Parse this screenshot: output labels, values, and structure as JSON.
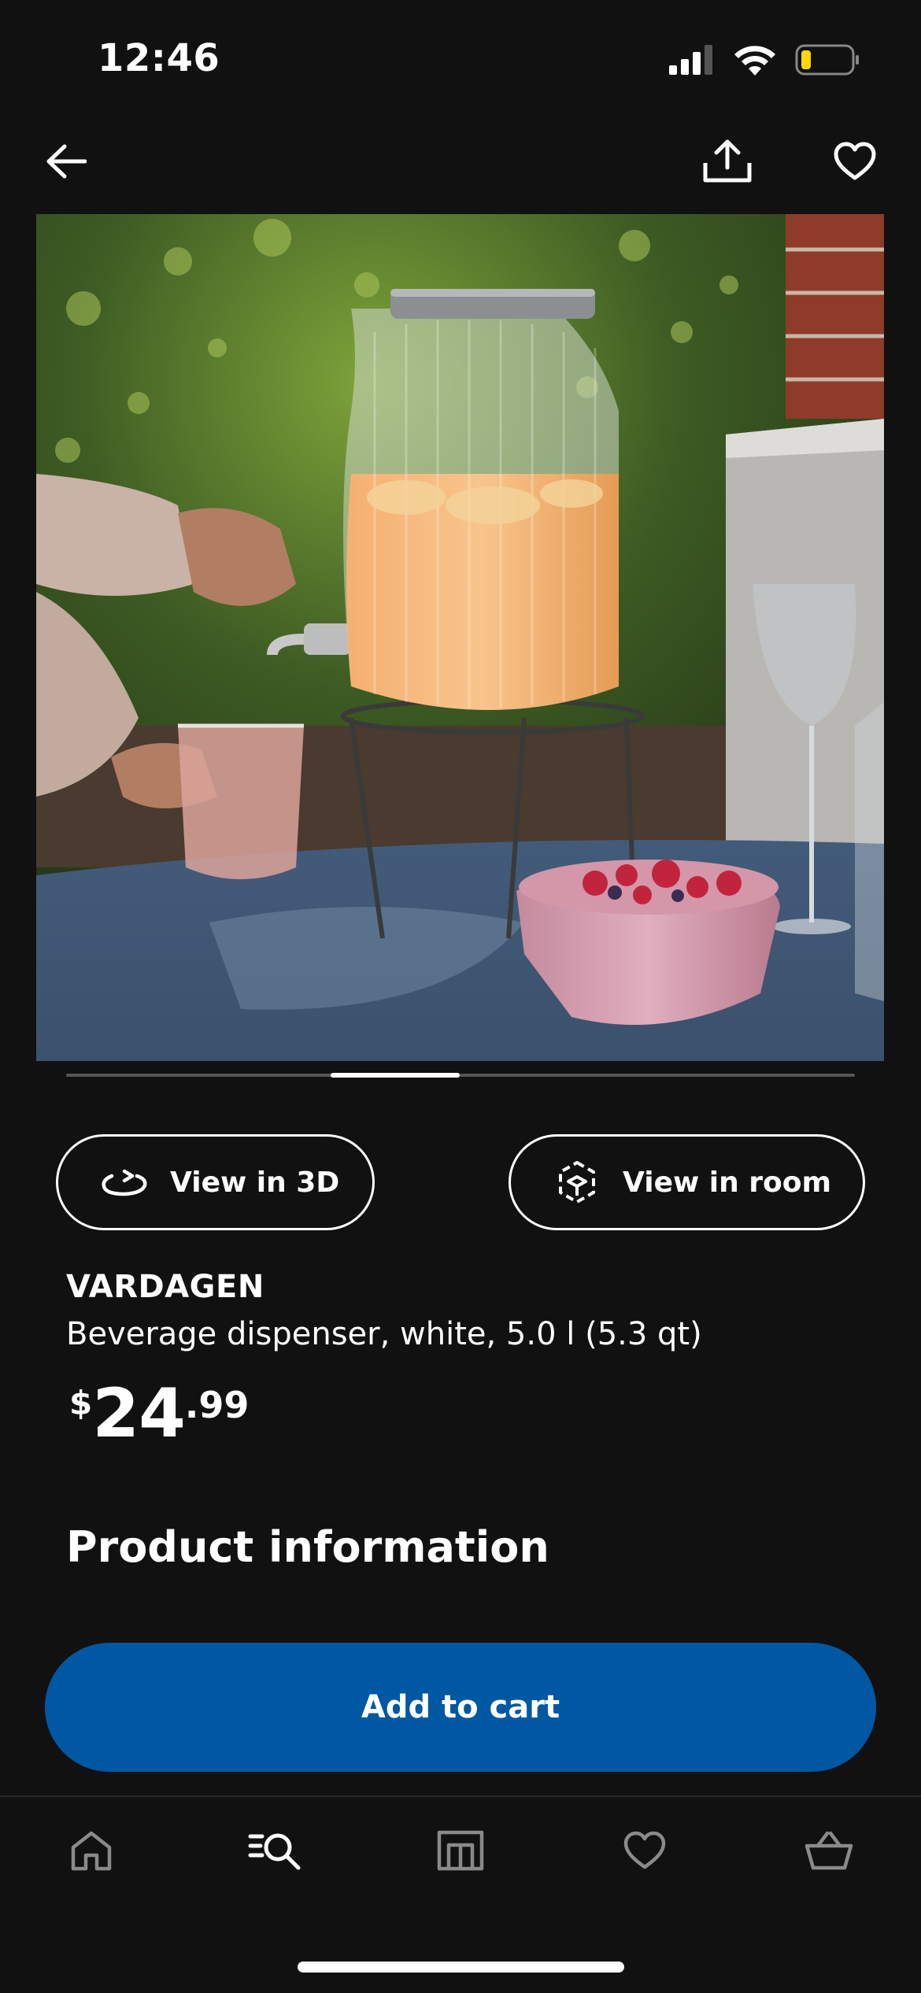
{
  "status_bar": {
    "time": "12:46"
  },
  "top_nav": {
    "back_icon": "arrow-left-icon",
    "share_icon": "share-icon",
    "favorite_icon": "heart-icon"
  },
  "image_gallery": {
    "current_index": 3,
    "total": 6
  },
  "actions": {
    "view_3d_label": "View in 3D",
    "view_room_label": "View in room"
  },
  "product": {
    "name": "VARDAGEN",
    "description": "Beverage dispenser, white, 5.0 l (5.3 qt)",
    "price": {
      "currency": "$",
      "integer": "24",
      "decimal": ".99"
    }
  },
  "section": {
    "title": "Product information"
  },
  "cta": {
    "label": "Add to cart",
    "color": "#0058a3"
  },
  "tab_bar": {
    "items": [
      {
        "icon": "home-icon",
        "active": false
      },
      {
        "icon": "search-icon",
        "active": true
      },
      {
        "icon": "store-icon",
        "active": false
      },
      {
        "icon": "heart-icon",
        "active": false
      },
      {
        "icon": "basket-icon",
        "active": false
      }
    ]
  }
}
